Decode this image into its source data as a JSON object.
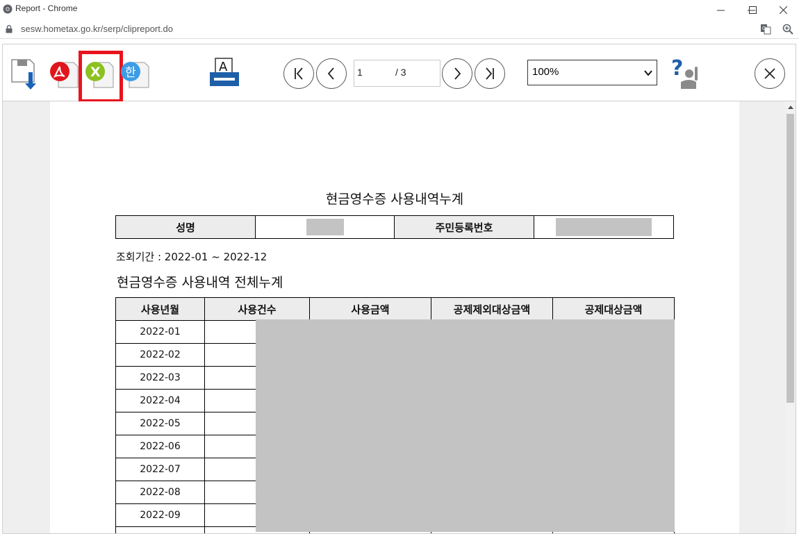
{
  "window": {
    "title": "Report - Chrome",
    "url": "sesw.hometax.go.kr/serp/clipreport.do"
  },
  "toolbar": {
    "page_current": "1",
    "page_total": "/ 3",
    "zoom_value": "100%",
    "icons": [
      "save-icon",
      "pdf-export-icon",
      "excel-export-icon",
      "hwp-export-icon",
      "print-icon",
      "first-page-icon",
      "prev-page-icon",
      "next-page-icon",
      "last-page-icon",
      "help-icon",
      "close-icon"
    ],
    "highlight_color": "#e8141e"
  },
  "report": {
    "title": "현금영수증 사용내역누계",
    "name_label": "성명",
    "id_label": "주민등록번호",
    "period": "조회기간 :  2022-01 ~ 2022-12",
    "subtitle": "현금영수증 사용내역 전체누계",
    "columns": [
      "사용년월",
      "사용건수",
      "사용금액",
      "공제제외대상금액",
      "공제대상금액"
    ],
    "rows": [
      "2022-01",
      "2022-02",
      "2022-03",
      "2022-04",
      "2022-05",
      "2022-06",
      "2022-07",
      "2022-08",
      "2022-09"
    ]
  }
}
